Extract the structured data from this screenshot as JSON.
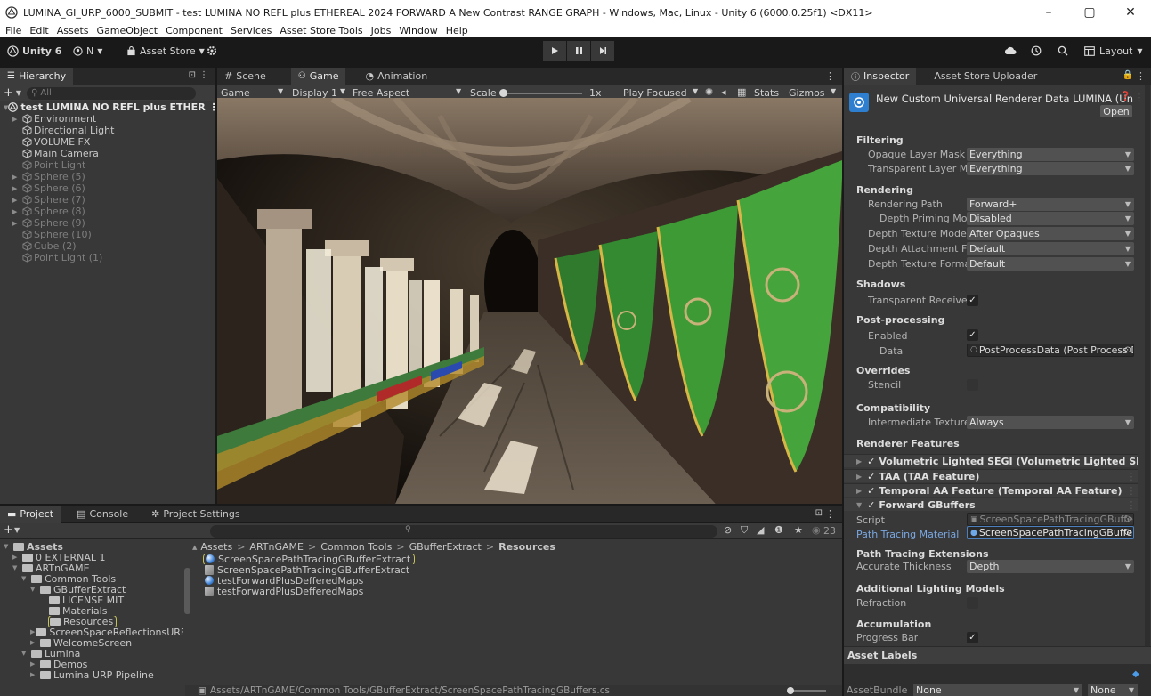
{
  "window": {
    "title": "LUMINA_GI_URP_6000_SUBMIT - test LUMINA NO REFL plus ETHEREAL 2024 FORWARD A New Contrast RANGE GRAPH - Windows, Mac, Linux - Unity 6 (6000.0.25f1) <DX11>",
    "minimize": "–",
    "maximize": "▢",
    "close": "✕"
  },
  "menu": [
    "File",
    "Edit",
    "Assets",
    "GameObject",
    "Component",
    "Services",
    "Asset Store Tools",
    "Jobs",
    "Window",
    "Help"
  ],
  "toolbar": {
    "unity_label": "Unity 6",
    "account_label": "N",
    "asset_store_label": "Asset Store",
    "layout_label": "Layout"
  },
  "hierarchy": {
    "tab": "Hierarchy",
    "search_placeholder": "All",
    "scene": "test LUMINA NO REFL plus ETHER",
    "items": [
      {
        "label": "Environment",
        "arrow": "▶",
        "dim": false
      },
      {
        "label": "Directional Light",
        "arrow": "",
        "dim": false
      },
      {
        "label": "VOLUME FX",
        "arrow": "",
        "dim": false
      },
      {
        "label": "Main Camera",
        "arrow": "",
        "dim": false
      },
      {
        "label": "Point Light",
        "arrow": "",
        "dim": true
      },
      {
        "label": "Sphere (5)",
        "arrow": "▶",
        "dim": true
      },
      {
        "label": "Sphere (6)",
        "arrow": "▶",
        "dim": true
      },
      {
        "label": "Sphere (7)",
        "arrow": "▶",
        "dim": true
      },
      {
        "label": "Sphere (8)",
        "arrow": "▶",
        "dim": true
      },
      {
        "label": "Sphere (9)",
        "arrow": "▶",
        "dim": true
      },
      {
        "label": "Sphere (10)",
        "arrow": "",
        "dim": true
      },
      {
        "label": "Cube (2)",
        "arrow": "",
        "dim": true
      },
      {
        "label": "Point Light (1)",
        "arrow": "",
        "dim": true
      }
    ]
  },
  "viewtabs": {
    "scene": "Scene",
    "game": "Game",
    "animation": "Animation"
  },
  "gamebar": {
    "mode": "Game",
    "display": "Display 1",
    "aspect": "Free Aspect",
    "scale_label": "Scale",
    "scale_value": "1x",
    "play_focused": "Play Focused",
    "stats": "Stats",
    "gizmos": "Gizmos"
  },
  "inspector": {
    "tab": "Inspector",
    "tab2": "Asset Store Uploader",
    "asset_name": "New Custom Universal Renderer Data LUMINA (Uni",
    "open_button": "Open",
    "sections": {
      "filtering": "Filtering",
      "rendering": "Rendering",
      "shadows": "Shadows",
      "postprocessing": "Post-processing",
      "overrides": "Overrides",
      "compatibility": "Compatibility",
      "renderer_features": "Renderer Features",
      "path_tracing_ext": "Path Tracing Extensions",
      "lighting_models": "Additional Lighting Models",
      "accumulation": "Accumulation",
      "asset_labels": "Asset Labels"
    },
    "fields": {
      "opaque_label": "Opaque Layer Mask",
      "opaque_value": "Everything",
      "transparent_label": "Transparent Layer Mas",
      "transparent_value": "Everything",
      "rendering_path_label": "Rendering Path",
      "rendering_path_value": "Forward+",
      "depth_priming_label": "Depth Priming Mode",
      "depth_priming_value": "Disabled",
      "depth_texture_mode_label": "Depth Texture Mode",
      "depth_texture_mode_value": "After Opaques",
      "depth_attachment_label": "Depth Attachment Fon",
      "depth_attachment_value": "Default",
      "depth_texture_format_label": "Depth Texture Format",
      "depth_texture_format_value": "Default",
      "transparent_receive_label": "Transparent Receive S",
      "enabled_label": "Enabled",
      "data_label": "Data",
      "data_value": "PostProcessData (Post Process Da",
      "stencil_label": "Stencil",
      "intermediate_label": "Intermediate Texture",
      "intermediate_value": "Always",
      "script_label": "Script",
      "script_value": "ScreenSpacePathTracingGBuffers",
      "ptm_label": "Path Tracing Material",
      "ptm_value": "ScreenSpacePathTracingGBufferE",
      "accurate_label": "Accurate Thickness",
      "accurate_value": "Depth",
      "refraction_label": "Refraction",
      "progress_label": "Progress Bar",
      "assetbundle_label": "AssetBundle",
      "assetbundle_value": "None",
      "assetbundle_variant": "None"
    },
    "features": [
      {
        "label": "Volumetric Lighted SEGI (Volumetric Lighted SEGI)",
        "arrow": "▶"
      },
      {
        "label": "TAA (TAA Feature)",
        "arrow": "▶"
      },
      {
        "label": "Temporal AA Feature (Temporal AA Feature)",
        "arrow": "▶"
      },
      {
        "label": "Forward GBuffers",
        "arrow": "▼"
      }
    ]
  },
  "bottomtabs": {
    "project": "Project",
    "console": "Console",
    "settings": "Project Settings",
    "count": "23"
  },
  "project": {
    "tree": [
      {
        "label": "Assets",
        "indent": 0,
        "bold": true,
        "arrow": "▼",
        "open": true
      },
      {
        "label": "0 EXTERNAL 1",
        "indent": 1,
        "bold": false,
        "arrow": "▶",
        "open": false
      },
      {
        "label": "ARTnGAME",
        "indent": 1,
        "bold": false,
        "arrow": "▼",
        "open": true
      },
      {
        "label": "Common Tools",
        "indent": 2,
        "bold": false,
        "arrow": "▼",
        "open": true
      },
      {
        "label": "GBufferExtract",
        "indent": 3,
        "bold": false,
        "arrow": "▼",
        "open": true
      },
      {
        "label": "LICENSE MIT",
        "indent": 4,
        "bold": false,
        "arrow": "",
        "open": false
      },
      {
        "label": "Materials",
        "indent": 4,
        "bold": false,
        "arrow": "",
        "open": false
      },
      {
        "label": "Resources",
        "indent": 4,
        "bold": false,
        "arrow": "",
        "open": false,
        "selected": true
      },
      {
        "label": "ScreenSpaceReflectionsURF",
        "indent": 3,
        "bold": false,
        "arrow": "▶",
        "open": false
      },
      {
        "label": "WelcomeScreen",
        "indent": 3,
        "bold": false,
        "arrow": "▶",
        "open": false
      },
      {
        "label": "Lumina",
        "indent": 2,
        "bold": false,
        "arrow": "▼",
        "open": true
      },
      {
        "label": "Demos",
        "indent": 3,
        "bold": false,
        "arrow": "▶",
        "open": false
      },
      {
        "label": "Lumina URP Pipeline",
        "indent": 3,
        "bold": false,
        "arrow": "▶",
        "open": false
      }
    ],
    "breadcrumb": [
      "Assets",
      "ARTnGAME",
      "Common Tools",
      "GBufferExtract",
      "Resources"
    ],
    "files": [
      {
        "label": "ScreenSpacePathTracingGBufferExtract",
        "type": "material",
        "selected": true
      },
      {
        "label": "ScreenSpacePathTracingGBufferExtract",
        "type": "shader",
        "selected": false
      },
      {
        "label": "testForwardPlusDefferedMaps",
        "type": "material",
        "selected": false
      },
      {
        "label": "testForwardPlusDefferedMaps",
        "type": "shader",
        "selected": false
      }
    ],
    "footer_path": "Assets/ARTnGAME/Common Tools/GBufferExtract/ScreenSpacePathTracingGBuffers.cs"
  },
  "colors": {
    "accent_blue": "#4c7fbd",
    "highlight_yellow": "#c5c25a",
    "link_blue": "#7aa8e3"
  }
}
